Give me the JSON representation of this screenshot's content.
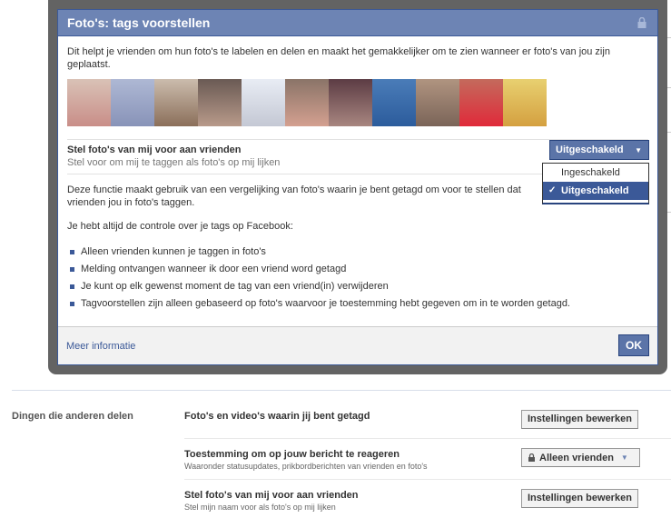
{
  "dialog": {
    "title": "Foto's: tags voorstellen",
    "intro": "Dit helpt je vrienden om hun foto's te labelen en delen en maakt het gemakkelijker om te zien wanneer er foto's van jou zijn geplaatst.",
    "setting_title": "Stel foto's van mij voor aan vrienden",
    "setting_sub": "Stel voor om mij te taggen als foto's op mij lijken",
    "select_value": "Uitgeschakeld",
    "options": [
      {
        "label": "Ingeschakeld",
        "selected": false
      },
      {
        "label": "Uitgeschakeld",
        "selected": true
      }
    ],
    "paragraph1": "Deze functie maakt gebruik van een vergelijking van foto's waarin je bent getagd om voor te stellen dat vrienden jou in foto's taggen.",
    "paragraph2": "Je hebt altijd de controle over je tags op Facebook:",
    "bullets": [
      "Alleen vrienden kunnen je taggen in foto's",
      "Melding ontvangen wanneer ik door een vriend word getagd",
      "Je kunt op elk gewenst moment de tag van een vriend(in) verwijderen",
      "Tagvoorstellen zijn alleen gebaseerd op foto's waarvoor je toestemming hebt gegeven om in te worden getagd."
    ],
    "more_link": "Meer informatie",
    "ok_label": "OK"
  },
  "settings": {
    "section_label": "Dingen die anderen delen",
    "rows": [
      {
        "title": "Foto's en video's waarin jij bent getagd",
        "sub": "",
        "button": "Instellingen bewerken"
      },
      {
        "title": "Toestemming om op jouw bericht te reageren",
        "sub": "Waaronder statusupdates, prikbordberichten van vrienden en foto's",
        "button": "Alleen vrienden"
      },
      {
        "title": "Stel foto's van mij voor aan vrienden",
        "sub": "Stel mijn naam voor als foto's op mij lijken",
        "button": "Instellingen bewerken"
      }
    ]
  },
  "colors": {
    "brand": "#3b5998",
    "title_bar": "#6d84b4",
    "button_blue": "#5b74a8"
  },
  "icons": {
    "title_lock": "lock-icon",
    "privacy_lock": "lock-icon",
    "dropdown_caret": "triangle-down",
    "check": "checkmark",
    "bullet": "square"
  }
}
